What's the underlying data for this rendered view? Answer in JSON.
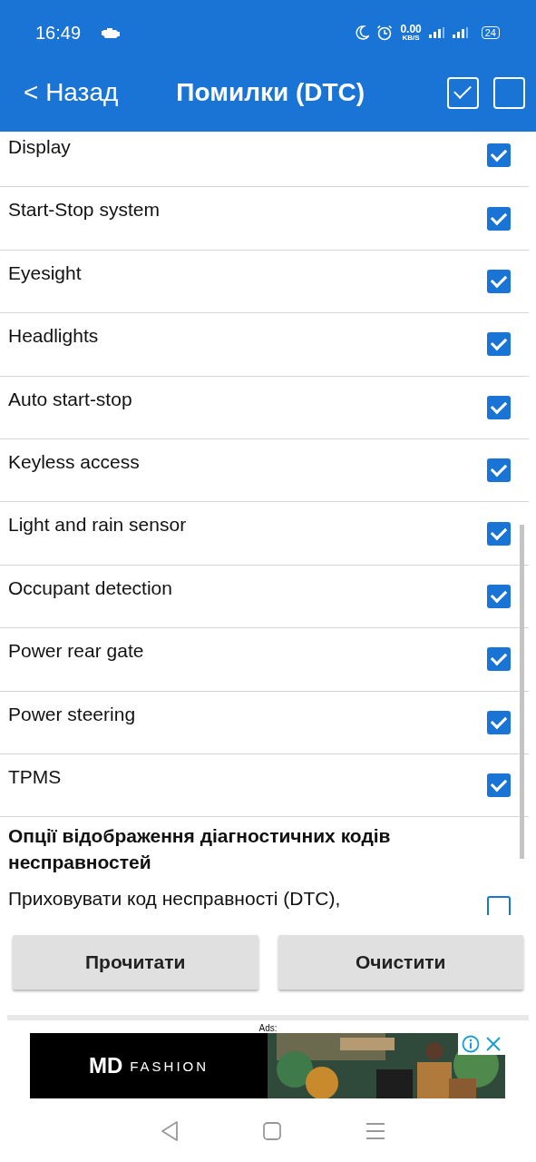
{
  "status_bar": {
    "time": "16:49",
    "speed_value": "0.00",
    "speed_unit": "KB/S",
    "battery": "24"
  },
  "header": {
    "back": "< Назад",
    "title": "Помилки (DTC)",
    "select_all": {
      "checked": true
    },
    "select_none": {
      "checked": false
    }
  },
  "items": [
    {
      "label": "Display",
      "checked": true
    },
    {
      "label": "Start-Stop system",
      "checked": true
    },
    {
      "label": "Eyesight",
      "checked": true
    },
    {
      "label": "Headlights",
      "checked": true
    },
    {
      "label": "Auto start-stop",
      "checked": true
    },
    {
      "label": "Keyless access",
      "checked": true
    },
    {
      "label": "Light and rain sensor",
      "checked": true
    },
    {
      "label": "Occupant detection",
      "checked": true
    },
    {
      "label": "Power rear gate",
      "checked": true
    },
    {
      "label": "Power steering",
      "checked": true
    },
    {
      "label": "TPMS",
      "checked": true
    }
  ],
  "options_section": {
    "title": "Опції відображення діагностичних кодів несправностей",
    "options": [
      {
        "label": "Приховувати код несправності (DTC),",
        "checked": false
      }
    ]
  },
  "buttons": [
    "Прочитати",
    "Очистити"
  ],
  "ad": {
    "label": "Ads:",
    "brand": "MD",
    "brand_suffix": "FASHION"
  }
}
